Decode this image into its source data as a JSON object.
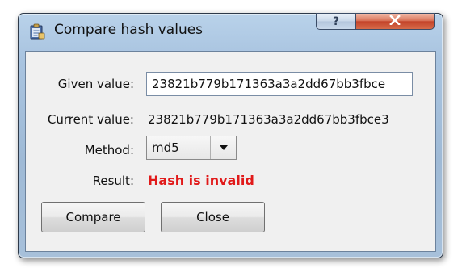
{
  "window": {
    "title": "Compare hash values",
    "icons": {
      "app": "clipboard-hash-icon",
      "help": "help-icon",
      "close": "close-icon"
    },
    "help_glyph": "?"
  },
  "form": {
    "given_label": "Given value:",
    "given_value": "23821b779b171363a3a2dd67bb3fbce",
    "current_label": "Current value:",
    "current_value": "23821b779b171363a3a2dd67bb3fbce3",
    "method_label": "Method:",
    "method_value": "md5",
    "result_label": "Result:",
    "result_value": "Hash is invalid",
    "result_color": "#e11a1a"
  },
  "buttons": {
    "compare": "Compare",
    "close": "Close"
  }
}
